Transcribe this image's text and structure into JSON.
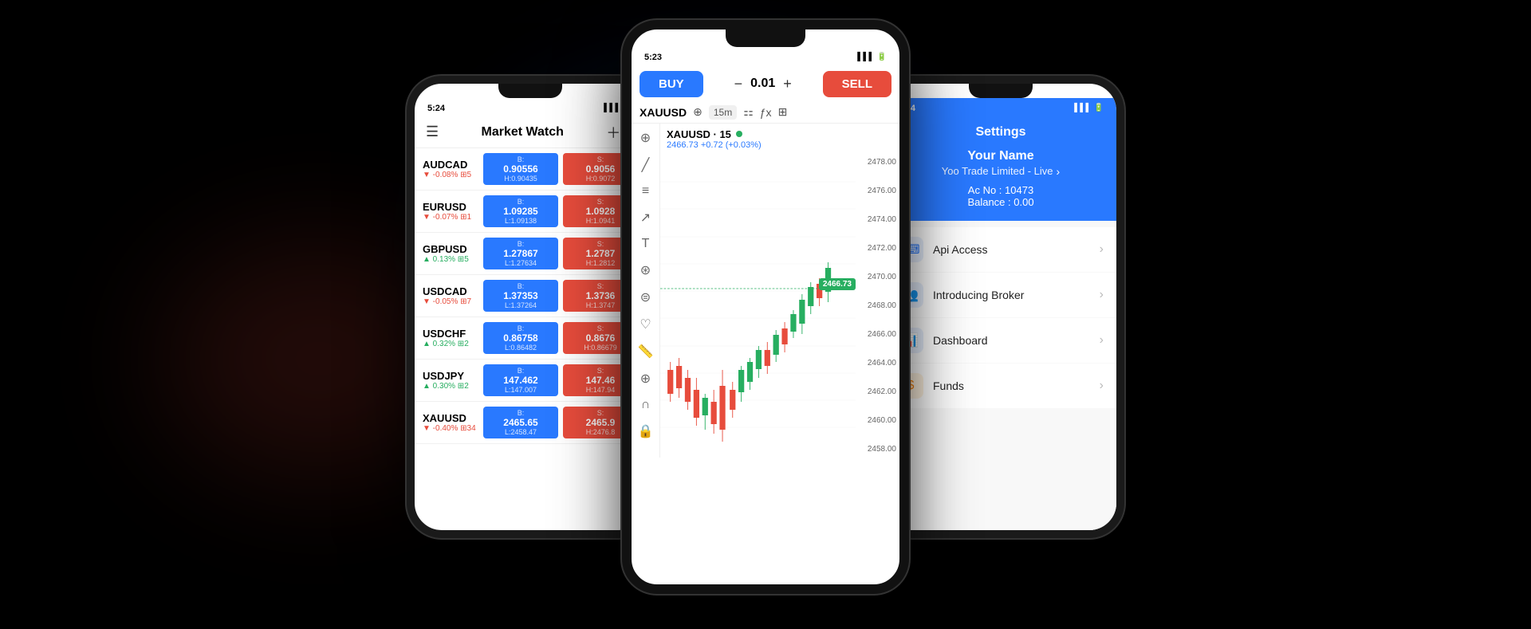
{
  "background": "#000000",
  "phones": {
    "left": {
      "time": "5:24",
      "title": "Market Watch",
      "symbols": [
        {
          "name": "AUDCAD",
          "change": "-0.08%",
          "changeDir": "negative",
          "lots": "5",
          "bid_label": "B:",
          "bid": "0.90556",
          "bid_sub": "H:0.90435",
          "ask_label": "S:",
          "ask": "0.9056",
          "ask_sub": "H:0.9072"
        },
        {
          "name": "EURUSD",
          "change": "-0.07%",
          "changeDir": "negative",
          "lots": "1",
          "bid_label": "B:",
          "bid": "1.09285",
          "bid_sub": "L:1.09138",
          "ask_label": "S:",
          "ask": "1.0928",
          "ask_sub": "H:1.0941"
        },
        {
          "name": "GBPUSD",
          "change": "0.13%",
          "changeDir": "positive",
          "lots": "5",
          "bid_label": "B:",
          "bid": "1.27867",
          "bid_sub": "L:1.27634",
          "ask_label": "S:",
          "ask": "1.2787",
          "ask_sub": "H:1.2812"
        },
        {
          "name": "USDCAD",
          "change": "-0.05%",
          "changeDir": "negative",
          "lots": "7",
          "bid_label": "B:",
          "bid": "1.37353",
          "bid_sub": "L:1.37264",
          "ask_label": "S:",
          "ask": "1.3736",
          "ask_sub": "H:1.3747"
        },
        {
          "name": "USDCHF",
          "change": "0.32%",
          "changeDir": "positive",
          "lots": "2",
          "bid_label": "B:",
          "bid": "0.86758",
          "bid_sub": "L:0.86482",
          "ask_label": "S:",
          "ask": "0.8676",
          "ask_sub": "H:0.86679"
        },
        {
          "name": "USDJPY",
          "change": "0.30%",
          "changeDir": "positive",
          "lots": "2",
          "bid_label": "B:",
          "bid": "147.462",
          "bid_sub": "L:147.007",
          "ask_label": "S:",
          "ask": "147.46",
          "ask_sub": "H:147.94"
        },
        {
          "name": "XAUUSD",
          "change": "-0.40%",
          "changeDir": "negative",
          "lots": "34",
          "bid_label": "B:",
          "bid": "2465.65",
          "bid_sub": "L:2458.47",
          "ask_label": "S:",
          "ask": "2465.9",
          "ask_sub": "H:2476.8"
        }
      ]
    },
    "center": {
      "time": "5:23",
      "buy_label": "BUY",
      "sell_label": "SELL",
      "lot_value": "0.01",
      "symbol": "XAUUSD",
      "timeframe": "15m",
      "chart_pair": "XAUUSD · 15",
      "chart_price": "2466.73 +0.72 (+0.03%)",
      "current_price": "2466.73",
      "price_levels": [
        "2478.00",
        "2476.00",
        "2474.00",
        "2472.00",
        "2470.00",
        "2468.00",
        "2466.00",
        "2464.00",
        "2462.00",
        "2460.00",
        "2458.00"
      ]
    },
    "right": {
      "time": "5:24",
      "title": "Settings",
      "user_name": "Your Name",
      "broker": "Yoo Trade Limited - Live",
      "ac_no": "Ac No : 10473",
      "balance": "Balance : 0.00",
      "menu_items": [
        {
          "icon": "⌨",
          "label": "Api Access",
          "icon_class": "icon-api"
        },
        {
          "icon": "👥",
          "label": "Introducing Broker",
          "icon_class": "icon-broker"
        },
        {
          "icon": "📊",
          "label": "Dashboard",
          "icon_class": "icon-dashboard"
        },
        {
          "icon": "$",
          "label": "Funds",
          "icon_class": "icon-funds"
        }
      ]
    }
  }
}
